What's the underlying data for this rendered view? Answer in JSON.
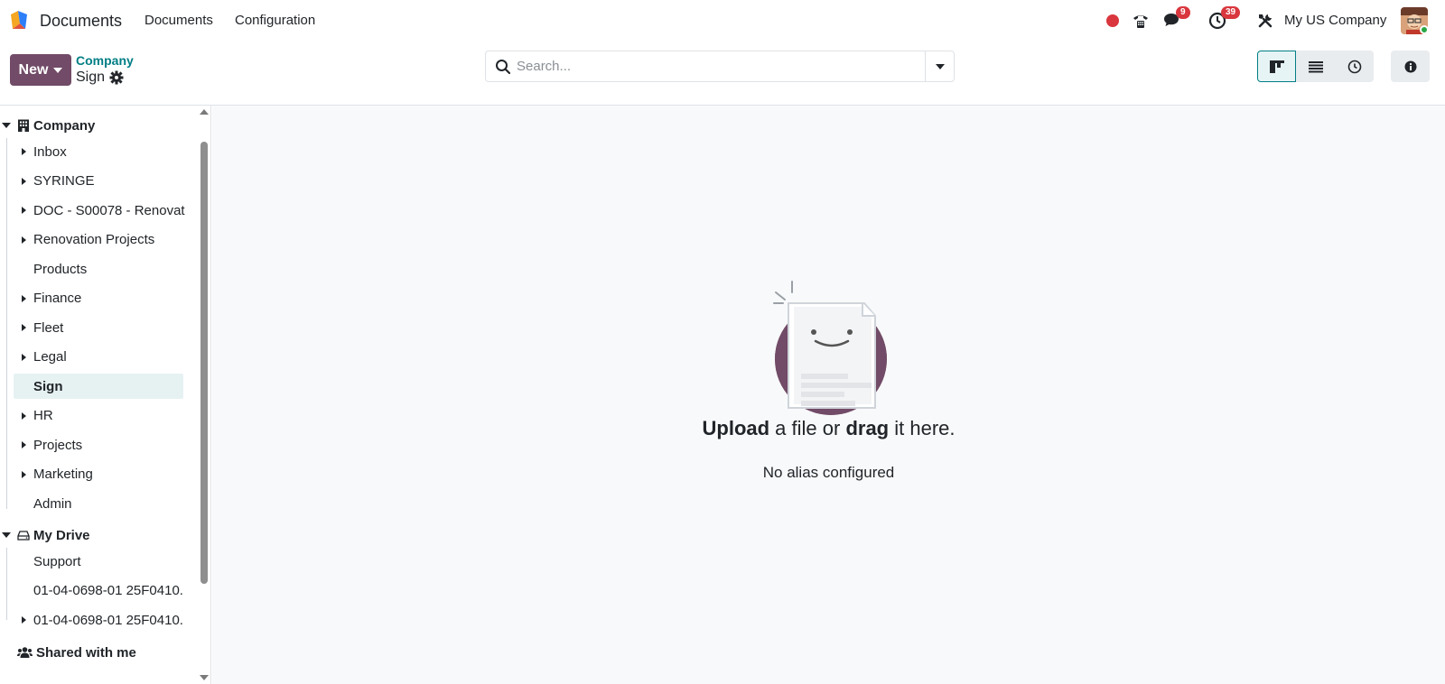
{
  "navbar": {
    "app_name": "Documents",
    "menu": [
      "Documents",
      "Configuration"
    ],
    "chat_count": "9",
    "activity_count": "39",
    "company": "My US Company"
  },
  "control_panel": {
    "new_label": "New",
    "breadcrumb_parent": "Company",
    "breadcrumb_current": "Sign",
    "search_placeholder": "Search..."
  },
  "sidebar": {
    "company_root": "Company",
    "company_items": [
      {
        "label": "Inbox",
        "expandable": true
      },
      {
        "label": "SYRINGE",
        "expandable": true
      },
      {
        "label": "DOC - S00078 - Renovat",
        "expandable": true
      },
      {
        "label": "Renovation Projects",
        "expandable": true
      },
      {
        "label": "Products",
        "expandable": false
      },
      {
        "label": "Finance",
        "expandable": true
      },
      {
        "label": "Fleet",
        "expandable": true
      },
      {
        "label": "Legal",
        "expandable": true
      },
      {
        "label": "Sign",
        "expandable": false,
        "selected": true
      },
      {
        "label": "HR",
        "expandable": true
      },
      {
        "label": "Projects",
        "expandable": true
      },
      {
        "label": "Marketing",
        "expandable": true
      },
      {
        "label": "Admin",
        "expandable": false
      }
    ],
    "drive_root": "My Drive",
    "drive_items": [
      {
        "label": "Support",
        "expandable": false
      },
      {
        "label": "01-04-0698-01 25F0410.",
        "expandable": false
      },
      {
        "label": "01-04-0698-01 25F0410.",
        "expandable": true
      }
    ],
    "shared_root": "Shared with me"
  },
  "empty_state": {
    "upload_word": "Upload",
    "middle_text": " a file or ",
    "drag_word": "drag",
    "end_text": " it here.",
    "subtitle": "No alias configured"
  },
  "colors": {
    "brand": "#714b67",
    "teal": "#017e84",
    "badge": "#d9363e"
  }
}
